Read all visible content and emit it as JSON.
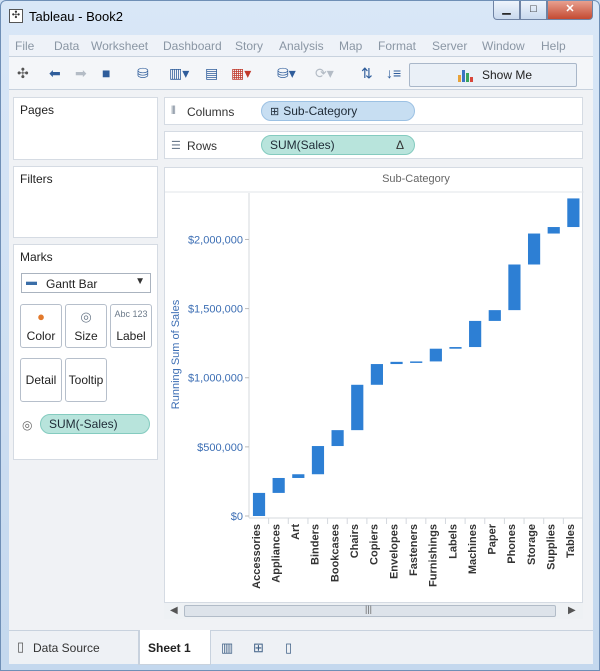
{
  "window": {
    "title": "Tableau - Book2",
    "minimize_glyph": "▁",
    "maximize_glyph": "□",
    "close_glyph": "✕"
  },
  "menu": [
    "File",
    "Data",
    "Worksheet",
    "Dashboard",
    "Story",
    "Analysis",
    "Map",
    "Format",
    "Server",
    "Window",
    "Help"
  ],
  "toolbar": {
    "icons": [
      "tableau-logo-icon",
      "undo-icon",
      "redo-icon",
      "save-icon",
      "new-datasource-icon",
      "new-worksheet-icon",
      "duplicate-sheet-icon",
      "clear-sheet-icon",
      "swap-icon",
      "refresh-icon",
      "group-icon",
      "sort-icon"
    ],
    "show_me_label": "Show Me"
  },
  "cards": {
    "pages_title": "Pages",
    "filters_title": "Filters",
    "marks_title": "Marks",
    "mark_type": "Gantt Bar",
    "buttons": {
      "color": "Color",
      "size": "Size",
      "label": "Label",
      "label_icon": "Abc 123",
      "detail": "Detail",
      "tooltip": "Tooltip"
    },
    "size_pill": "SUM(-Sales)"
  },
  "shelves": {
    "columns_label": "Columns",
    "columns_pill": "Sub-Category",
    "rows_label": "Rows",
    "rows_pill": "SUM(Sales)",
    "rows_pill_delta": "Δ"
  },
  "bottom_tabs": {
    "data_source": "Data Source",
    "sheet": "Sheet 1"
  },
  "colors": {
    "bar": "#2d7fd4",
    "axis_text": "#3c6eb4",
    "pill_blue": "#c7def2",
    "pill_green": "#b8e4dc"
  },
  "chart_data": {
    "type": "bar",
    "subtype": "waterfall-gantt",
    "header": "Sub-Category",
    "ylabel": "Running Sum of Sales",
    "ylim": [
      0,
      2300000
    ],
    "yticks": [
      0,
      500000,
      1000000,
      1500000,
      2000000
    ],
    "ytick_labels": [
      "$0",
      "$500,000",
      "$1,000,000",
      "$1,500,000",
      "$2,000,000"
    ],
    "categories": [
      "Accessories",
      "Appliances",
      "Art",
      "Binders",
      "Bookcases",
      "Chairs",
      "Copiers",
      "Envelopes",
      "Fasteners",
      "Furnishings",
      "Labels",
      "Machines",
      "Paper",
      "Phones",
      "Storage",
      "Supplies",
      "Tables"
    ],
    "values": [
      167000,
      108000,
      27000,
      204000,
      115000,
      328000,
      150000,
      16000,
      3000,
      92000,
      12000,
      189000,
      78000,
      330000,
      224000,
      47000,
      207000
    ],
    "running_end": [
      167000,
      275000,
      302000,
      506000,
      621000,
      949000,
      1099000,
      1115000,
      1118000,
      1210000,
      1222000,
      1411000,
      1489000,
      1819000,
      2043000,
      2090000,
      2297000
    ]
  }
}
